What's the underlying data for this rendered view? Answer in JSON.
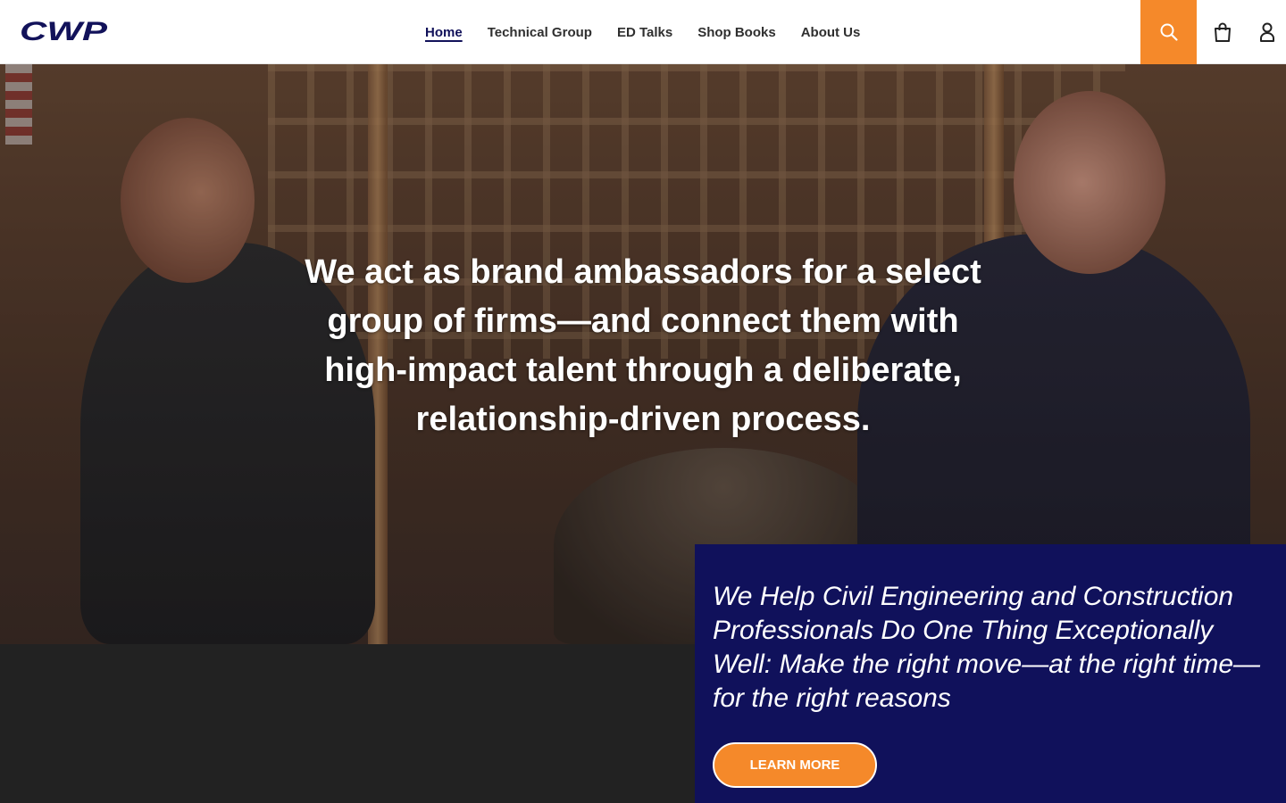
{
  "brand": {
    "logo_text": "CWP",
    "logo_color": "#12125a"
  },
  "nav": {
    "items": [
      {
        "label": "Home",
        "active": true
      },
      {
        "label": "Technical Group",
        "active": false
      },
      {
        "label": "ED Talks",
        "active": false
      },
      {
        "label": "Shop Books",
        "active": false
      },
      {
        "label": "About Us",
        "active": false
      }
    ]
  },
  "header_actions": {
    "search_icon": "search-icon",
    "cart_icon": "cart-icon",
    "account_icon": "account-icon",
    "search_color": "#f5892a"
  },
  "hero": {
    "headline": "We act as brand ambassadors for a select group of firms—and connect them with high-impact talent through a deliberate, relationship-driven process."
  },
  "promo": {
    "text": "We Help Civil Engineering and Construction Professionals Do One Thing Exceptionally Well: Make the right move—at the right time—for the right reasons",
    "button_label": "LEARN MORE",
    "background": "#10115b",
    "button_color": "#f5892a"
  }
}
